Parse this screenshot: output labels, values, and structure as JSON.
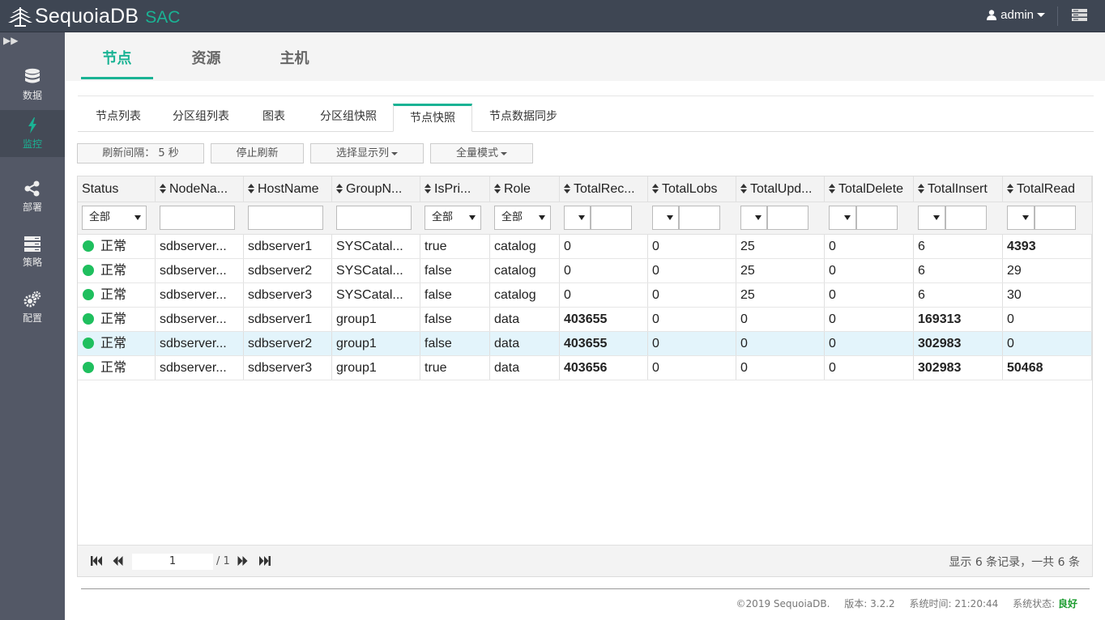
{
  "app": {
    "name": "SequoiaDB",
    "sub": "SAC"
  },
  "user": {
    "name": "admin"
  },
  "sidebar": [
    {
      "label": "数据",
      "icon": "database-icon"
    },
    {
      "label": "监控",
      "icon": "lightning-icon",
      "active": true
    },
    {
      "label": "部署",
      "icon": "share-icon"
    },
    {
      "label": "策略",
      "icon": "server-icon"
    },
    {
      "label": "配置",
      "icon": "gears-icon"
    }
  ],
  "main_tabs": [
    "节点",
    "资源",
    "主机"
  ],
  "sub_tabs": [
    "节点列表",
    "分区组列表",
    "图表",
    "分区组快照",
    "节点快照",
    "节点数据同步"
  ],
  "toolbar": {
    "refresh_interval": "刷新间隔： 5 秒",
    "stop_refresh": "停止刷新",
    "select_columns": "选择显示列",
    "full_mode": "全量模式"
  },
  "columns": [
    "Status",
    "NodeNa...",
    "HostName",
    "GroupN...",
    "IsPri...",
    "Role",
    "TotalRec...",
    "TotalLobs",
    "TotalUpd...",
    "TotalDelete",
    "TotalInsert",
    "TotalRead"
  ],
  "filters": {
    "status": "全部",
    "is_primary": "全部",
    "role": "全部"
  },
  "rows": [
    {
      "status": "正常",
      "node": "sdbserver...",
      "host": "sdbserver1",
      "group": "SYSCatal...",
      "primary": "true",
      "role": "catalog",
      "rec": "0",
      "lobs": "0",
      "upd": "25",
      "del": "0",
      "ins": "6",
      "read": "4393"
    },
    {
      "status": "正常",
      "node": "sdbserver...",
      "host": "sdbserver2",
      "group": "SYSCatal...",
      "primary": "false",
      "role": "catalog",
      "rec": "0",
      "lobs": "0",
      "upd": "25",
      "del": "0",
      "ins": "6",
      "read": "29"
    },
    {
      "status": "正常",
      "node": "sdbserver...",
      "host": "sdbserver3",
      "group": "SYSCatal...",
      "primary": "false",
      "role": "catalog",
      "rec": "0",
      "lobs": "0",
      "upd": "25",
      "del": "0",
      "ins": "6",
      "read": "30"
    },
    {
      "status": "正常",
      "node": "sdbserver...",
      "host": "sdbserver1",
      "group": "group1",
      "primary": "false",
      "role": "data",
      "rec": "403655",
      "lobs": "0",
      "upd": "0",
      "del": "0",
      "ins": "169313",
      "read": "0"
    },
    {
      "status": "正常",
      "node": "sdbserver...",
      "host": "sdbserver2",
      "group": "group1",
      "primary": "false",
      "role": "data",
      "rec": "403655",
      "lobs": "0",
      "upd": "0",
      "del": "0",
      "ins": "302983",
      "read": "0"
    },
    {
      "status": "正常",
      "node": "sdbserver...",
      "host": "sdbserver3",
      "group": "group1",
      "primary": "true",
      "role": "data",
      "rec": "403656",
      "lobs": "0",
      "upd": "0",
      "del": "0",
      "ins": "302983",
      "read": "50468"
    }
  ],
  "pager": {
    "page": "1",
    "total": "/ 1",
    "info": "显示 6 条记录，一共 6 条"
  },
  "footer": {
    "copyright": "©2019 SequoiaDB.",
    "version": "版本: 3.2.2",
    "time": "系统时间: 21:20:44",
    "status_label": "系统状态:",
    "status_value": "良好"
  }
}
